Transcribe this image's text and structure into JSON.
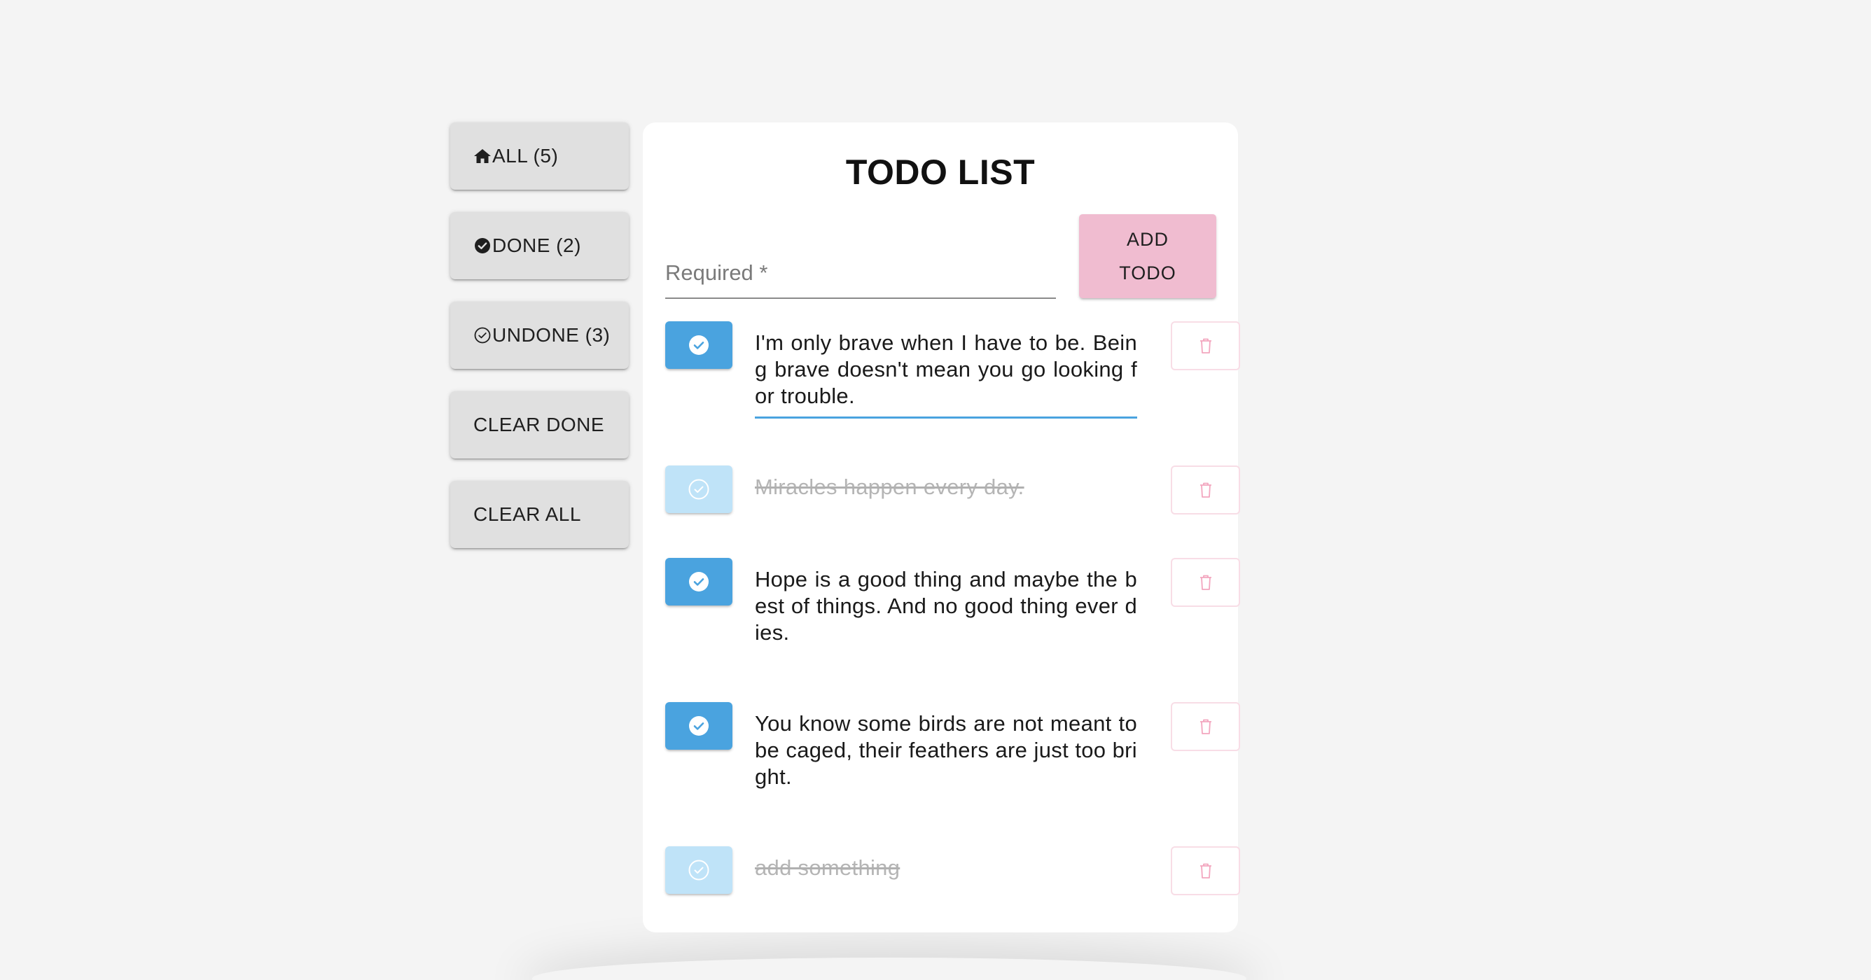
{
  "sidebar": {
    "items": [
      {
        "label": "ALL (5)",
        "icon": "home-icon"
      },
      {
        "label": "DONE (2)",
        "icon": "check-circle-filled-icon"
      },
      {
        "label": "UNDONE (3)",
        "icon": "check-circle-outline-icon"
      },
      {
        "label": "CLEAR DONE"
      },
      {
        "label": "CLEAR ALL"
      }
    ]
  },
  "main": {
    "title": "TODO LIST",
    "input": {
      "placeholder": "Required *",
      "value": ""
    },
    "add_button": {
      "label": "ADD TODO"
    },
    "todos": [
      {
        "text": "I'm only brave when I have to be. Being brave doesn't mean you go looking for trouble.",
        "done": false,
        "editing": true
      },
      {
        "text": "Miracles happen every day.",
        "done": true,
        "editing": false
      },
      {
        "text": "Hope is a good thing and maybe the best of things. And no good thing ever dies.",
        "done": false,
        "editing": false
      },
      {
        "text": "You know some birds are not meant to be caged, their feathers are just too bright.",
        "done": false,
        "editing": false
      },
      {
        "text": "add something",
        "done": true,
        "editing": false
      }
    ]
  },
  "colors": {
    "check_active": "#4aa3df",
    "check_done": "#bfe3f8",
    "add_button": "#f0bcd0",
    "delete_icon": "#f3a6bf",
    "background": "#f4f4f4"
  }
}
